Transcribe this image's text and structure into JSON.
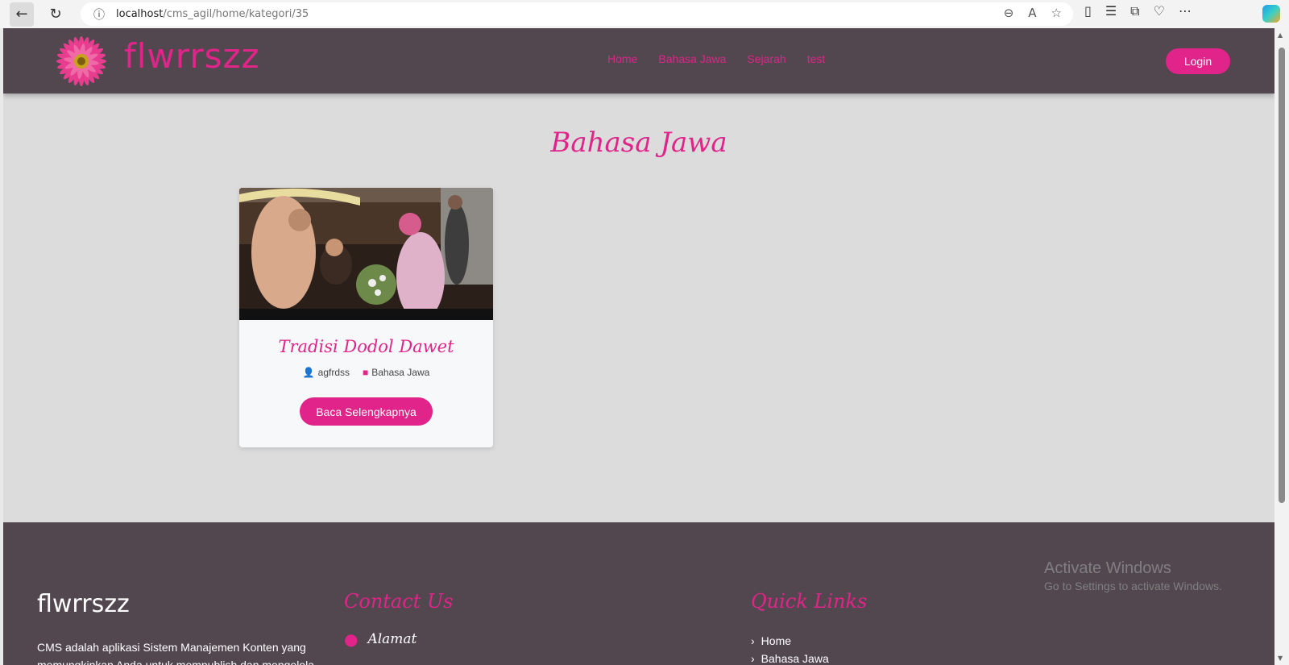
{
  "browser": {
    "url_host": "localhost",
    "url_path": "/cms_agil/home/kategori/35"
  },
  "header": {
    "brand": "flwrrszz",
    "nav": [
      "Home",
      "Bahasa Jawa",
      "Sejarah",
      "test"
    ],
    "login_label": "Login"
  },
  "page": {
    "title": "Bahasa Jawa"
  },
  "posts": [
    {
      "title": "Tradisi Dodol Dawet",
      "author": "agfrdss",
      "category": "Bahasa Jawa",
      "button": "Baca Selengkapnya"
    }
  ],
  "footer": {
    "brand": "flwrrszz",
    "description": "CMS adalah aplikasi Sistem Manajemen Konten yang memungkinkan Anda untuk mempublish dan mengelola",
    "contact_heading": "Contact Us",
    "contact_address_label": "Alamat",
    "quicklinks_heading": "Quick Links",
    "quicklinks": [
      "Home",
      "Bahasa Jawa"
    ]
  },
  "windows_watermark": {
    "line1": "Activate Windows",
    "line2": "Go to Settings to activate Windows."
  },
  "colors": {
    "accent": "#e0248a",
    "header_bg": "#53474f",
    "page_bg": "#dcdcdc"
  }
}
